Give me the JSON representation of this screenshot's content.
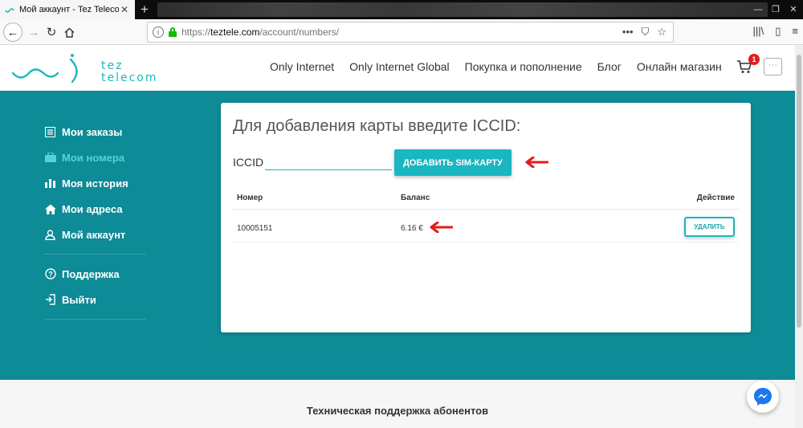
{
  "browser": {
    "tab_title": "Мой аккаунт - Tez Telecom",
    "tab_close": "✕",
    "new_tab": "+",
    "url_scheme": "https://",
    "url_host": "teztele.com",
    "url_path": "/account/numbers/",
    "info_glyph": "i",
    "url_actions": [
      "•••",
      "⛉",
      "☆"
    ],
    "right_tools": [
      "|||\\",
      "▯",
      "≡"
    ]
  },
  "header": {
    "logo_line1": "tez",
    "logo_line2": "telecom",
    "menu": [
      "Only Internet",
      "Only Internet Global",
      "Покупка и пополнение",
      "Блог",
      "Онлайн магазин"
    ],
    "cart_count": "1",
    "more_label": "···"
  },
  "sidebar": {
    "group1": [
      {
        "label": "Мои заказы",
        "icon": "list-icon",
        "active": false
      },
      {
        "label": "Мои номера",
        "icon": "sim-card-icon",
        "active": true
      },
      {
        "label": "Моя история",
        "icon": "bar-chart-icon",
        "active": false
      },
      {
        "label": "Мои адреса",
        "icon": "home-icon",
        "active": false
      },
      {
        "label": "Мой аккаунт",
        "icon": "user-icon",
        "active": false
      }
    ],
    "group2": [
      {
        "label": "Поддержка",
        "icon": "help-icon"
      },
      {
        "label": "Выйти",
        "icon": "logout-icon"
      }
    ]
  },
  "card": {
    "title": "Для добавления карты введите ICCID:",
    "iccid_label": "ICCID",
    "iccid_value": "",
    "add_button": "ДОБАВИТЬ SIM-КАРТУ",
    "table": {
      "columns": [
        "Номер",
        "Баланс",
        "Действие"
      ],
      "rows": [
        {
          "number": "10005151",
          "balance": "6.16 €",
          "action": "УДАЛИТЬ"
        }
      ]
    }
  },
  "footer": {
    "text": "Техническая поддержка абонентов"
  },
  "colors": {
    "teal_bg": "#0d8b96",
    "accent": "#1ab6c1",
    "active_sidebar": "#5bd0d8",
    "arrow_red": "#e41b1b",
    "badge_red": "#e02020"
  }
}
